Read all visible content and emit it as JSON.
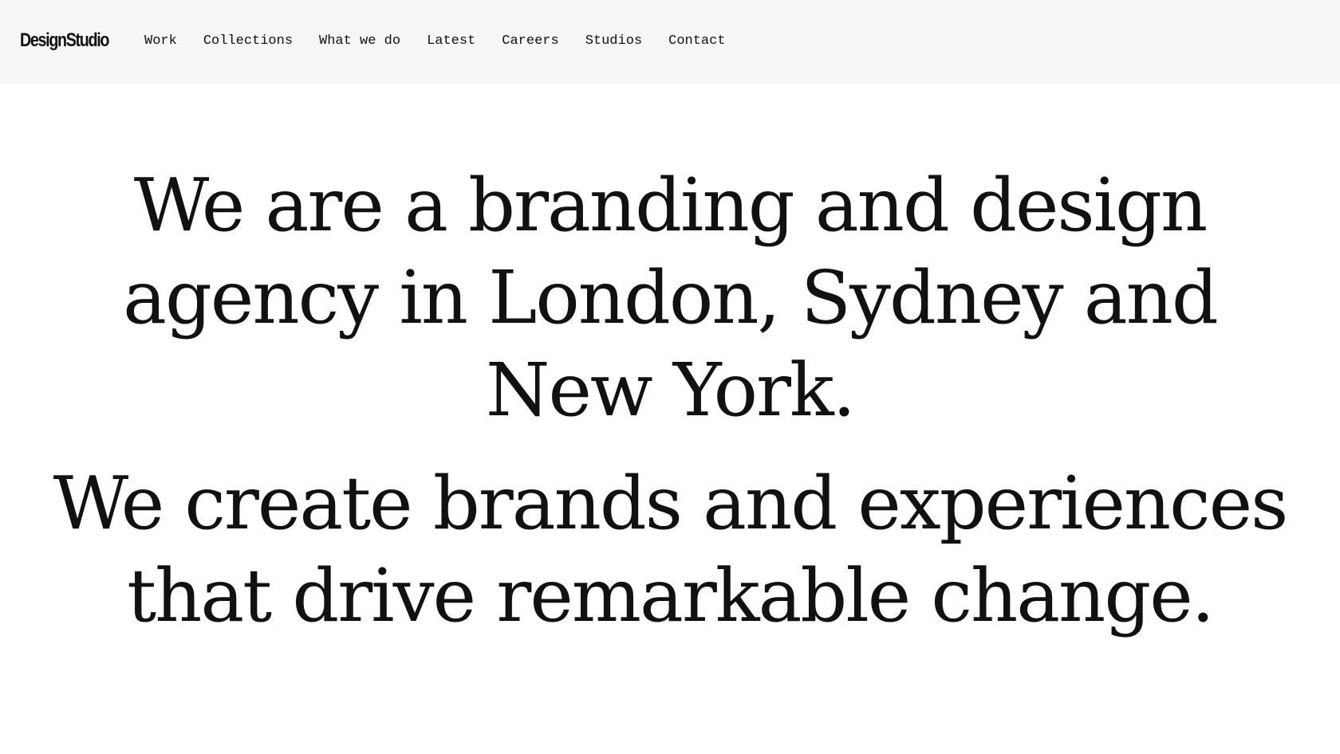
{
  "header": {
    "logo": "DesignStudio",
    "nav": [
      {
        "label": "Work"
      },
      {
        "label": "Collections"
      },
      {
        "label": "What we do"
      },
      {
        "label": "Latest"
      },
      {
        "label": "Careers"
      },
      {
        "label": "Studios"
      },
      {
        "label": "Contact"
      }
    ]
  },
  "hero": {
    "statement_1": "We are a branding and design agency in London, Sydney and New York.",
    "statement_2": "We create brands and experiences that drive remarkable change."
  },
  "colors": {
    "header_background": "#f6f6f6",
    "page_background": "#ffffff",
    "text": "#111111"
  }
}
